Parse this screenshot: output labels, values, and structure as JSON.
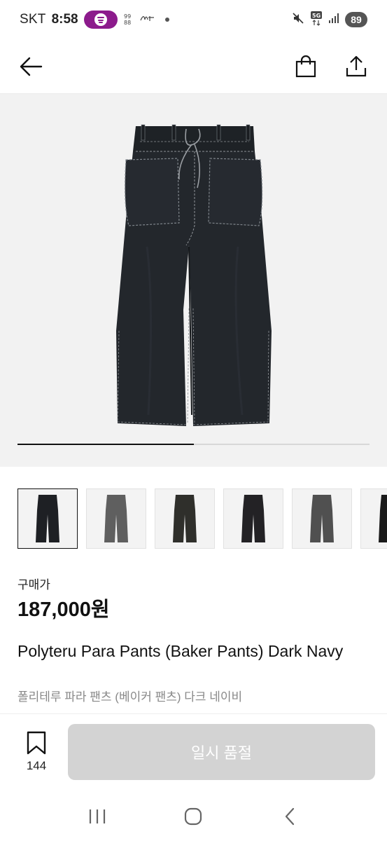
{
  "status_bar": {
    "carrier": "SKT",
    "time": "8:58",
    "battery": "89",
    "icons": [
      "spotify-icon",
      "notification-icon",
      "mute-icon",
      "5g-icon",
      "signal-icon"
    ]
  },
  "header": {
    "icons": [
      "back-arrow-icon",
      "shopping-bag-icon",
      "share-icon"
    ]
  },
  "gallery": {
    "progress": 0.5,
    "thumbnails": [
      {
        "color": "#1e2024",
        "selected": true
      },
      {
        "color": "#5f5f5f",
        "selected": false
      },
      {
        "color": "#2f2f2b",
        "selected": false
      },
      {
        "color": "#232225",
        "selected": false
      },
      {
        "color": "#505050",
        "selected": false
      },
      {
        "color": "#1a1a1a",
        "selected": false
      }
    ]
  },
  "product": {
    "price_label": "구매가",
    "price": "187,000원",
    "name": "Polyteru Para Pants (Baker Pants) Dark Navy",
    "name_ko": "폴리테루 파라 팬츠 (베이커 팬츠) 다크 네이비"
  },
  "action_bar": {
    "wish_count": "144",
    "button_label": "일시 품절"
  },
  "system_nav": {
    "icons": [
      "recent-apps-icon",
      "home-icon",
      "back-icon"
    ]
  },
  "colors": {
    "pants": "#22262b",
    "pants_stitch": "#8f9398",
    "spotify": "#8c1b8c",
    "disabled_button": "#d3d3d3",
    "hero_bg": "#f2f2f2"
  }
}
